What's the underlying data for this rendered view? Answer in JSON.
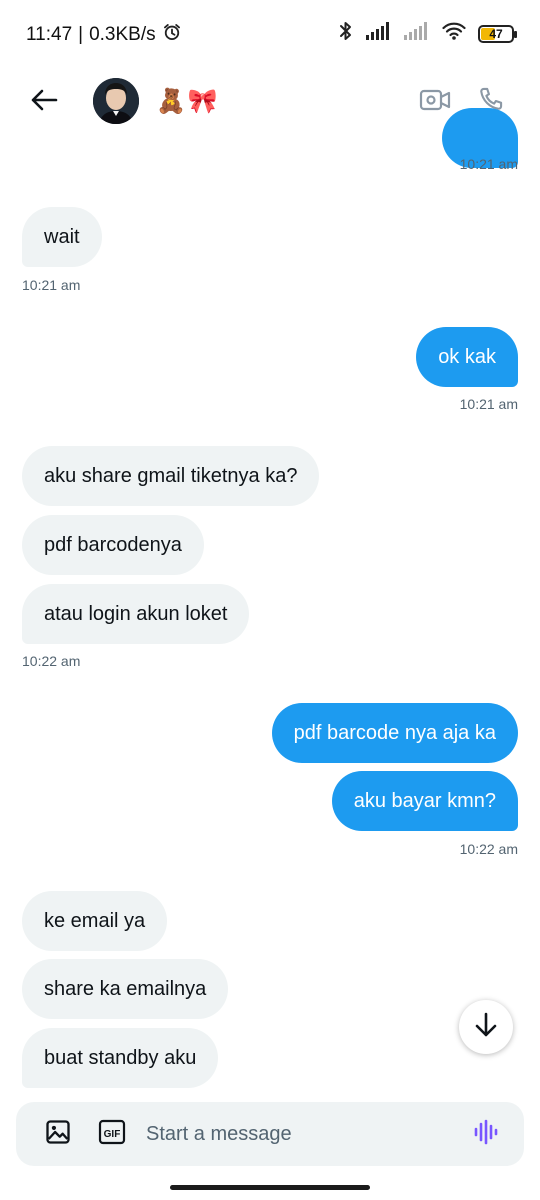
{
  "status_bar": {
    "time": "11:47",
    "network_speed": "0.3KB/s",
    "battery_level": "47",
    "battery_fraction": 0.47
  },
  "header": {
    "contact_name": "🧸🎀"
  },
  "messages": [
    {
      "direction": "out",
      "text": "",
      "partial": true
    },
    {
      "direction": "out-ts",
      "time": "10:21 am"
    },
    {
      "direction": "in",
      "text": "wait"
    },
    {
      "direction": "in-ts",
      "time": "10:21 am"
    },
    {
      "direction": "out",
      "text": "ok kak"
    },
    {
      "direction": "out-ts",
      "time": "10:21 am"
    },
    {
      "direction": "in",
      "text": "aku share gmail tiketnya ka?"
    },
    {
      "direction": "in",
      "text": "pdf barcodenya"
    },
    {
      "direction": "in",
      "text": "atau login akun loket"
    },
    {
      "direction": "in-ts",
      "time": "10:22 am"
    },
    {
      "direction": "out",
      "text": "pdf barcode nya aja ka"
    },
    {
      "direction": "out",
      "text": "aku bayar kmn?"
    },
    {
      "direction": "out-ts",
      "time": "10:22 am"
    },
    {
      "direction": "in",
      "text": "ke email ya"
    },
    {
      "direction": "in",
      "text": "share ka emailnya"
    },
    {
      "direction": "in",
      "text": "buat standby aku"
    }
  ],
  "composer": {
    "placeholder": "Start a message",
    "gif_label": "GIF"
  },
  "colors": {
    "outgoing_bubble": "#1d9bf0",
    "incoming_bubble": "#eff3f4",
    "timestamp": "#536471",
    "voice_icon": "#7856ff"
  },
  "icons": [
    "back-arrow-icon",
    "video-call-icon",
    "phone-call-icon",
    "media-icon",
    "gif-icon",
    "voice-message-icon",
    "arrow-down-icon",
    "alarm-icon",
    "bluetooth-icon",
    "signal-icon",
    "wifi-icon"
  ]
}
